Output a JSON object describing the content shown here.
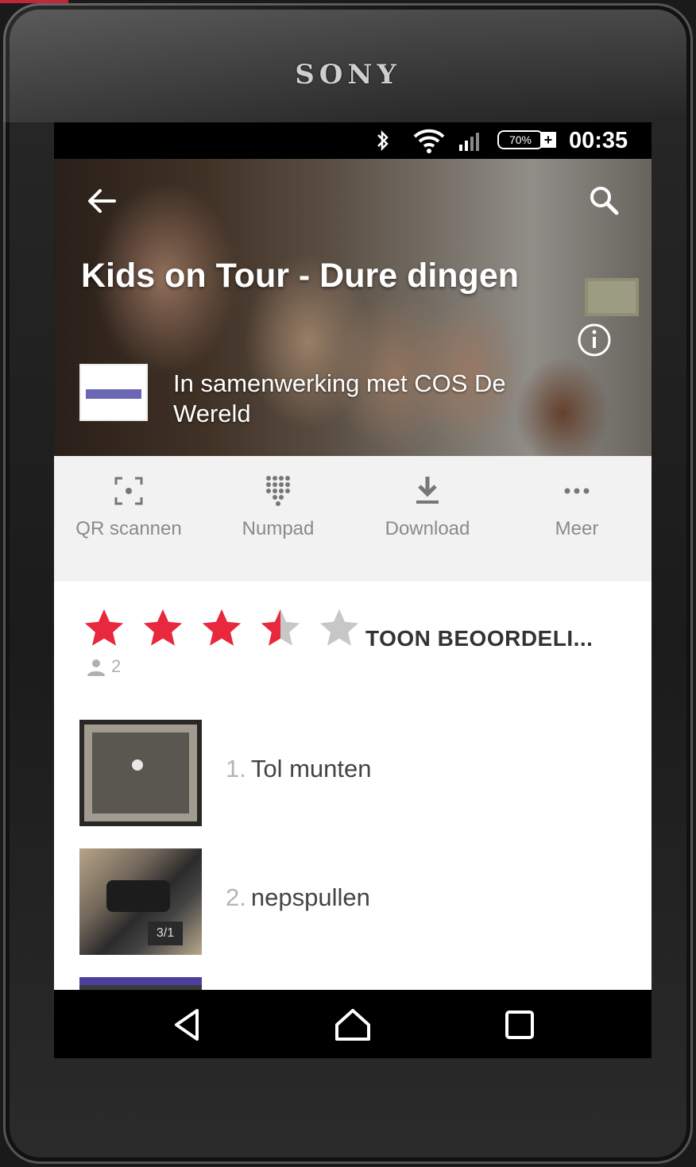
{
  "device": {
    "brand": "SONY"
  },
  "status_bar": {
    "battery": "70%",
    "time": "00:35"
  },
  "header": {
    "title": "Kids on Tour - Dure dingen",
    "organization": "In samenwerking met COS De Wereld"
  },
  "actions": [
    {
      "label": "QR scannen",
      "icon": "qr-scan-icon"
    },
    {
      "label": "Numpad",
      "icon": "numpad-icon"
    },
    {
      "label": "Download",
      "icon": "download-icon"
    },
    {
      "label": "Meer",
      "icon": "more-icon"
    }
  ],
  "rating": {
    "stars": 3.5,
    "max_stars": 5,
    "raters": "2",
    "show_reviews_label": "TOON BEOORDELI..."
  },
  "list": [
    {
      "number": "1.",
      "title": "Tol munten"
    },
    {
      "number": "2.",
      "title": "nepspullen"
    }
  ],
  "colors": {
    "star_filled": "#e8283c",
    "star_empty": "#c7c7c7",
    "action_bar": "#f2f2f2"
  }
}
